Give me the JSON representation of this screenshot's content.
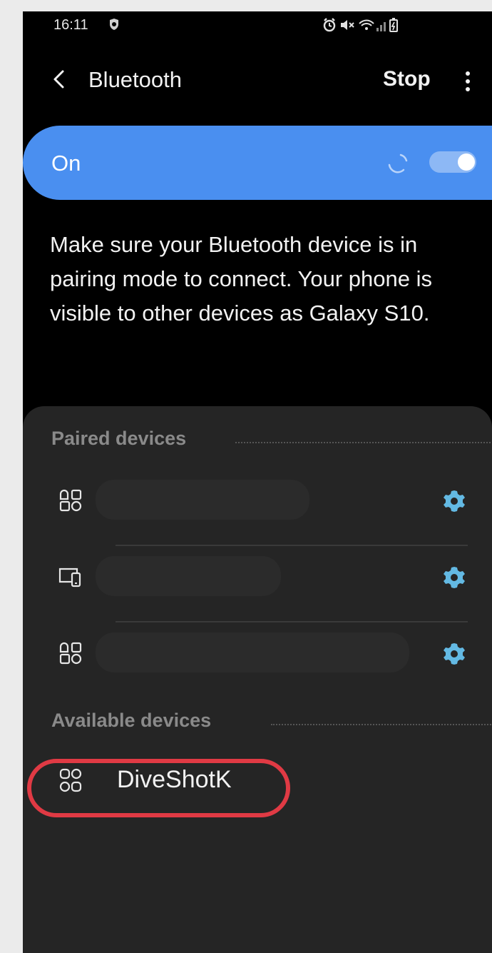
{
  "status_bar": {
    "time": "16:11"
  },
  "app_bar": {
    "title": "Bluetooth",
    "stop_label": "Stop"
  },
  "toggle_bar": {
    "label": "On",
    "state": "on",
    "accent_color": "#4a8ff0"
  },
  "info": {
    "text": "Make sure your Bluetooth device is in pairing mode to connect. Your phone is visible to other devices as Galaxy S10."
  },
  "paired_section": {
    "title": "Paired devices",
    "devices": [
      {
        "icon": "generic-device-icon"
      },
      {
        "icon": "phone-tablet-icon"
      },
      {
        "icon": "generic-device-icon"
      }
    ]
  },
  "available_section": {
    "title": "Available devices",
    "devices": [
      {
        "name": "DiveShotK",
        "icon": "generic-device-icon"
      }
    ]
  },
  "colors": {
    "background": "#000000",
    "panel": "#252525",
    "settings_icon": "#63b9e3",
    "highlight_ring": "#e03a44"
  }
}
